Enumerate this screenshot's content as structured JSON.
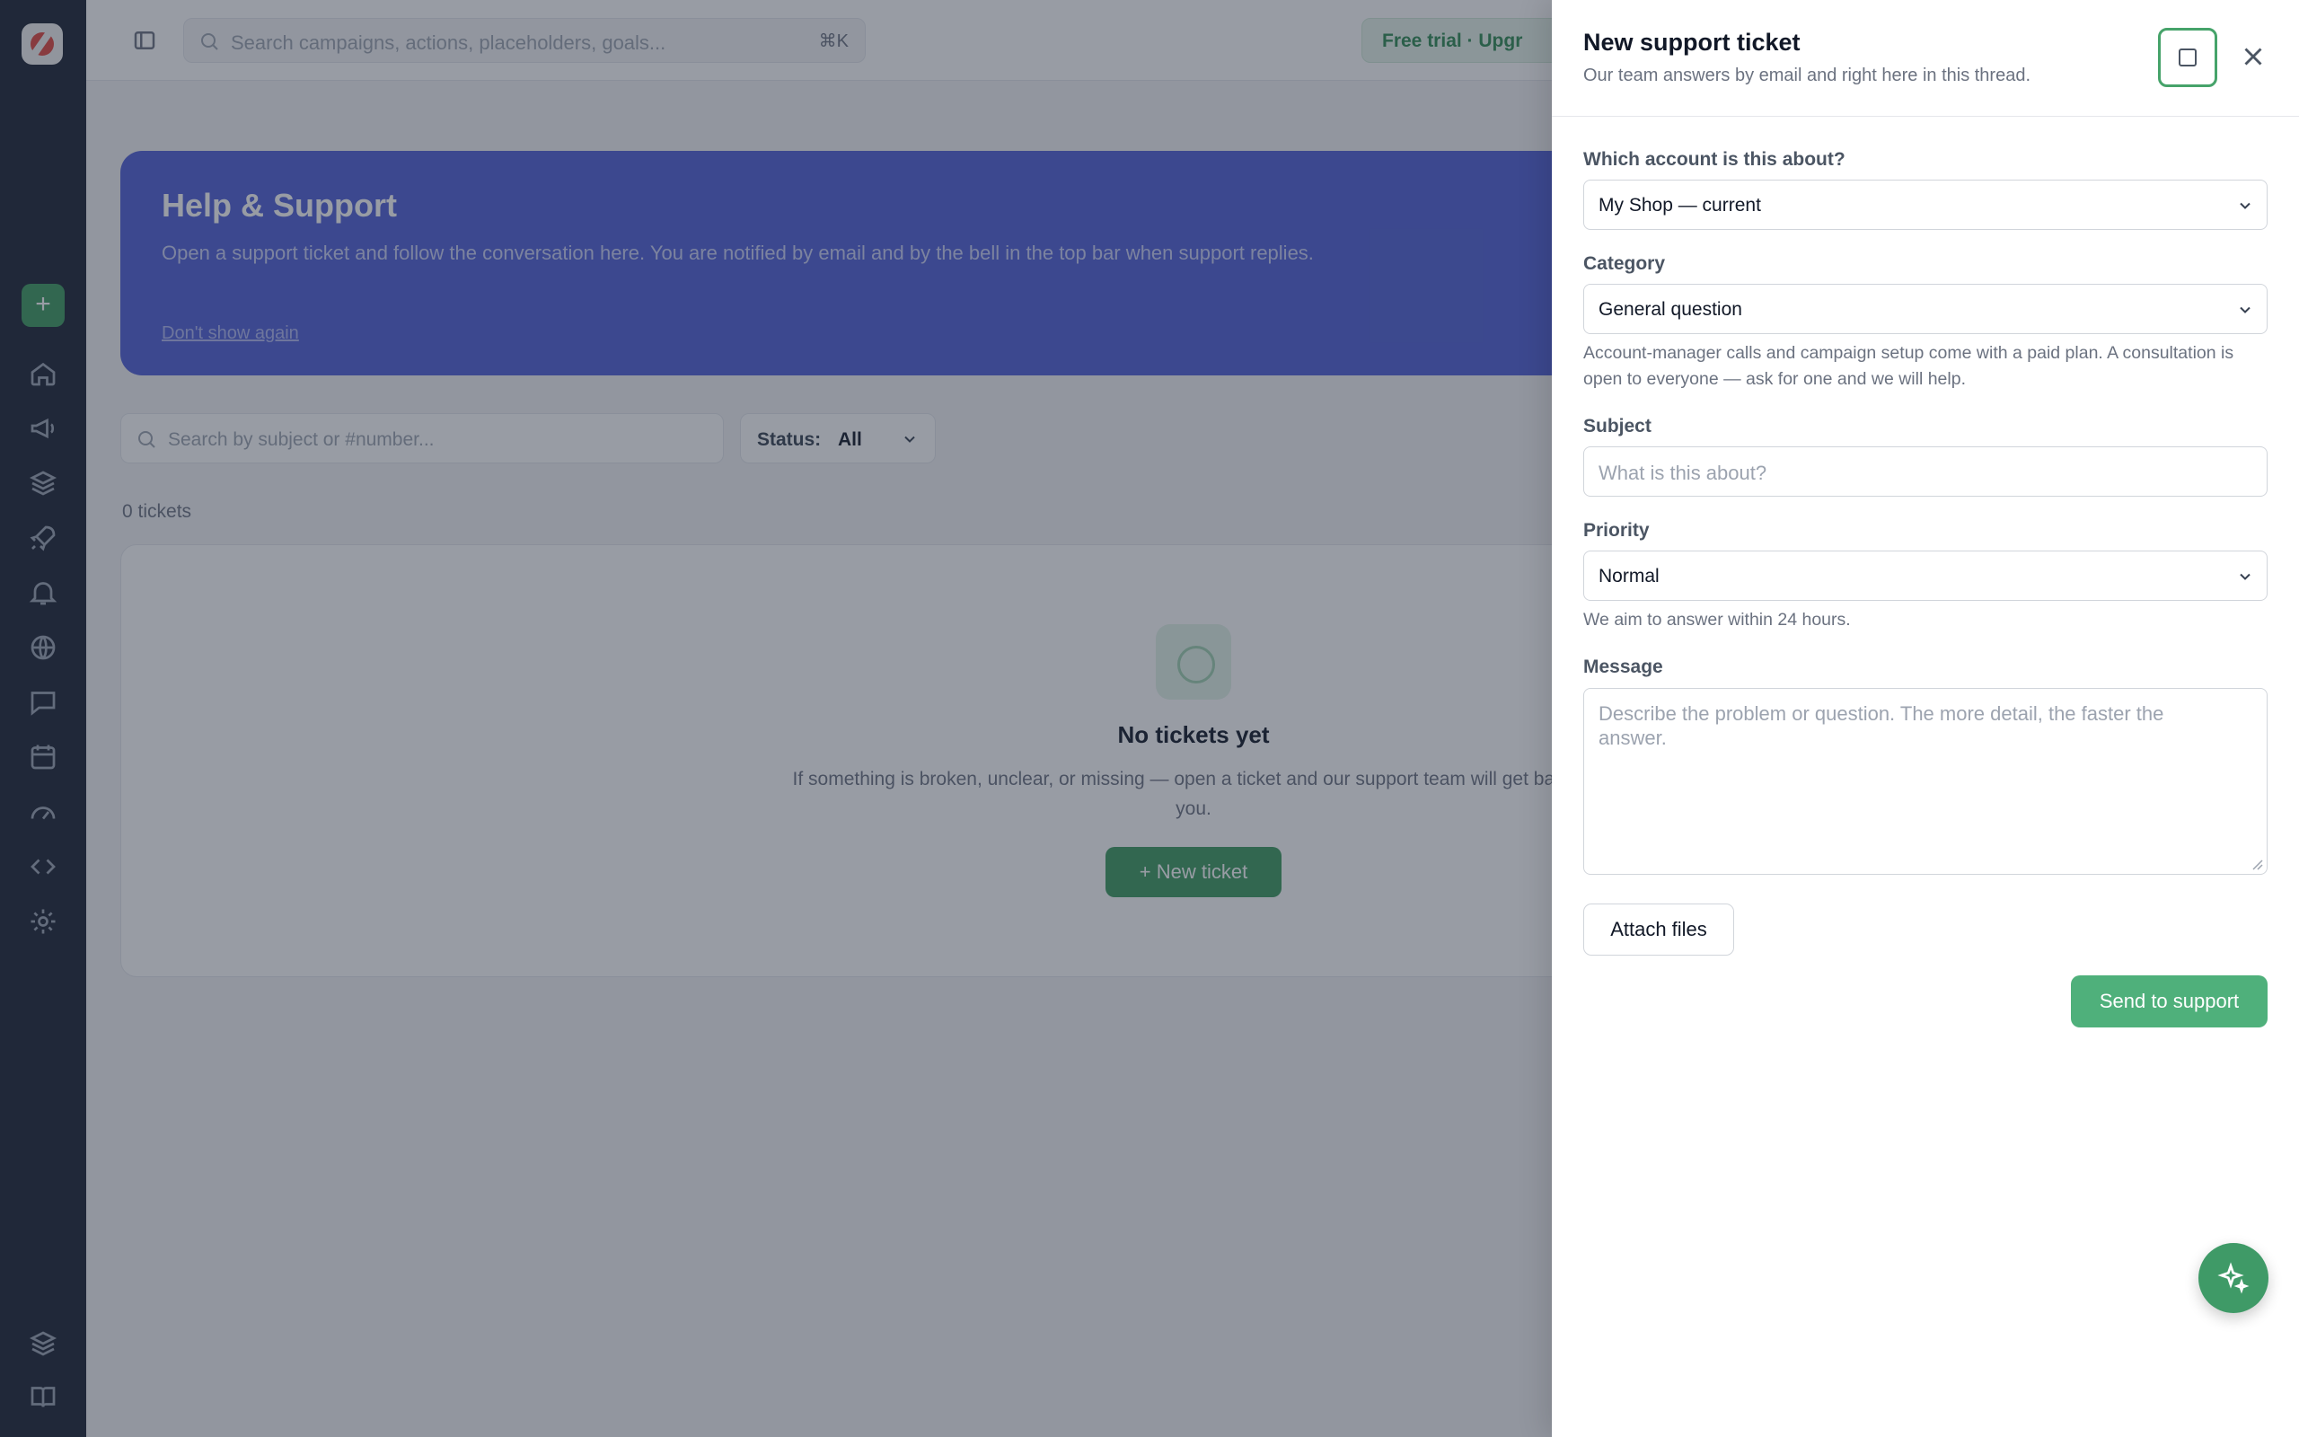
{
  "colors": {
    "rail_bg": "#1a2132",
    "accent_green": "#3c9a5f",
    "banner_blue": "#4f5fd6",
    "send_button": "#4fb07b"
  },
  "topbar": {
    "search_placeholder": "Search campaigns, actions, placeholders, goals...",
    "search_shortcut": "⌘K",
    "trial_label": "Free trial · Upgr"
  },
  "banner": {
    "title": "Help & Support",
    "description": "Open a support ticket and follow the conversation here. You are notified by email and by the bell in the top bar when support replies.",
    "dismiss_link": "Don't show again"
  },
  "filters": {
    "search_placeholder": "Search by subject or #number...",
    "status_label": "Status:",
    "status_value": "All"
  },
  "ticket_count": "0 tickets",
  "empty_state": {
    "title": "No tickets yet",
    "description": "If something is broken, unclear, or missing — open a ticket and our support team will get back to you.",
    "button_label": "+ New ticket"
  },
  "drawer": {
    "title": "New support ticket",
    "subtitle": "Our team answers by email and right here in this thread.",
    "account": {
      "label": "Which account is this about?",
      "value": "My Shop — current"
    },
    "category": {
      "label": "Category",
      "value": "General question",
      "hint": "Account-manager calls and campaign setup come with a paid plan. A consultation is open to everyone — ask for one and we will help."
    },
    "subject": {
      "label": "Subject",
      "placeholder": "What is this about?"
    },
    "priority": {
      "label": "Priority",
      "value": "Normal",
      "hint": "We aim to answer within 24 hours."
    },
    "message": {
      "label": "Message",
      "placeholder": "Describe the problem or question. The more detail, the faster the answer."
    },
    "attach_label": "Attach files",
    "send_label": "Send to support"
  },
  "icons": {
    "rail": [
      "home-icon",
      "megaphone-icon",
      "layers-icon",
      "rocket-icon",
      "bell-icon",
      "globe-icon",
      "chat-icon",
      "calendar-icon",
      "gauge-icon",
      "code-icon",
      "settings-icon",
      "layers-icon",
      "book-icon"
    ],
    "fab": "sparkle-icon"
  }
}
